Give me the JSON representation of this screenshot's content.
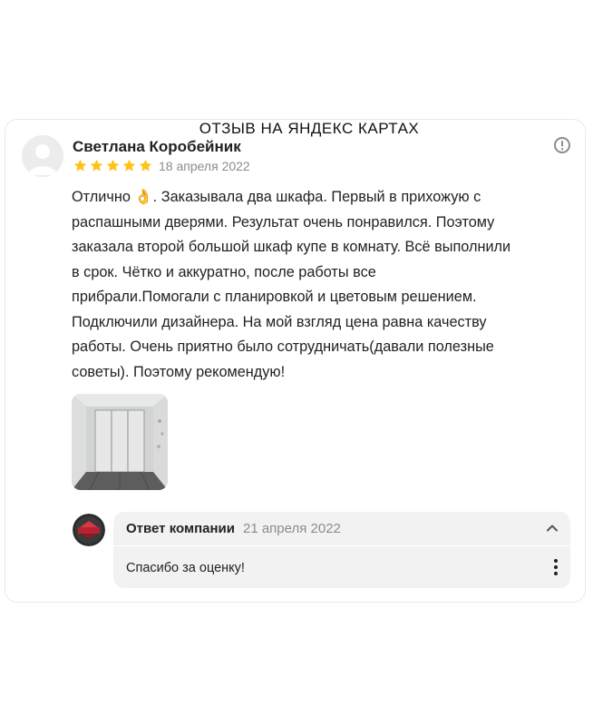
{
  "banner": {
    "title": "ОТЗЫВ НА ЯНДЕКС КАРТАХ"
  },
  "review": {
    "author": "Светлана Коробейник",
    "rating": 5,
    "rating_max": 5,
    "date": "18 апреля 2022",
    "text": "Отлично 👌. Заказывала два шкафа. Первый в прихожую с\nраспашными дверями. Результат очень понравился. Поэтому\nзаказала второй большой шкаф купе в комнату. Всё выполнили\nв срок. Чётко и аккуратно, после работы все\nприбрали.Помогали с планировкой и цветовым решением.\nПодключили дизайнера. На мой взгляд цена равна качеству\nработы. Очень приятно было сотрудничать(давали полезные\nсоветы). Поэтому рекомендую!",
    "photo_count": 1
  },
  "reply": {
    "title": "Ответ компании",
    "date": "21 апреля 2022",
    "text": "Спасибо за оценку!"
  },
  "icons": {
    "star": "star-icon",
    "info": "info-icon",
    "chevron": "chevron-up-icon",
    "more": "more-vertical-icon"
  },
  "colors": {
    "star": "#fcc419",
    "muted_text": "#8c8c8c",
    "reply_bg": "#f2f2f2",
    "card_border": "#e9e9e9"
  }
}
